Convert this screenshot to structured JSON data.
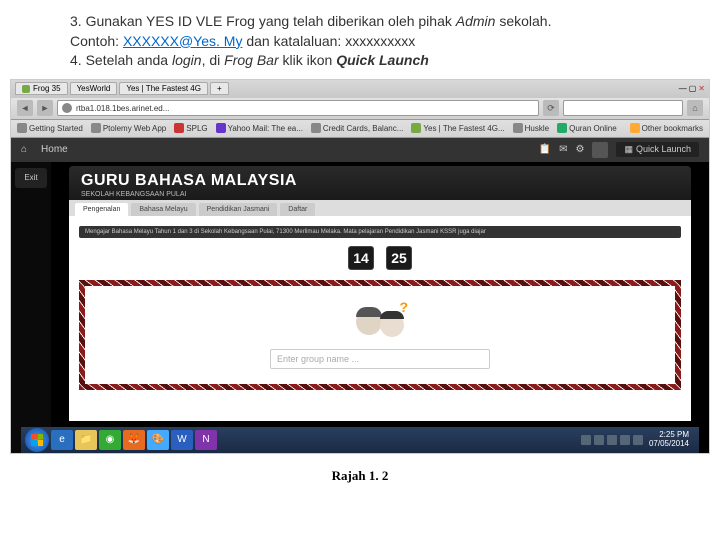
{
  "instructions": {
    "step3_a": "3. Gunakan YES ID VLE Frog yang telah diberikan oleh pihak ",
    "step3_admin": "Admin",
    "step3_b": " sekolah.",
    "step3_contoh_label": "Contoh: ",
    "step3_email": "XXXXXX@Yes. My",
    "step3_kata": " dan katalaluan: xxxxxxxxxx",
    "step4_a": "4. Setelah anda ",
    "step4_login": "login",
    "step4_b": ", di ",
    "step4_frogbar": "Frog Bar",
    "step4_c": " klik ikon ",
    "step4_quick": "Quick Launch"
  },
  "browser": {
    "tabs": [
      "Frog 35",
      "YesWorld",
      "Yes | The Fastest 4G",
      "+"
    ],
    "url": "rtba1.018.1bes.arinet.ed...",
    "bookmarks": [
      "Getting Started",
      "Ptolemy Web App",
      "SPLG",
      "Yahoo Mail: The ea...",
      "Credit Cards, Balanc...",
      "Yes | The Fastest 4G...",
      "Huskle",
      "Quran Online"
    ],
    "other_bookmarks": "Other bookmarks"
  },
  "frogbar": {
    "home": "Home",
    "quick_launch": "Quick Launch",
    "exit": "Exit"
  },
  "page": {
    "title": "GURU BAHASA MALAYSIA",
    "subtitle": "SEKOLAH KEBANGSAAN PULAI",
    "tabs": [
      "Pengenalan",
      "Bahasa Melayu",
      "Pendidikan Jasmani",
      "Daftar"
    ],
    "lesson_text": "Mengajar Bahasa Melayu Tahun 1 dan 3 di Sekolah Kebangsaan Pulai, 71300 Merlimau Melaka. Mata pelajaran Pendidikan Jasmani KSSR juga diajar",
    "clock_h": "14",
    "clock_m": "25",
    "group_placeholder": "Enter group name ..."
  },
  "taskbar": {
    "time": "2:25 PM",
    "date": "07/05/2014"
  },
  "caption": "Rajah 1. 2"
}
